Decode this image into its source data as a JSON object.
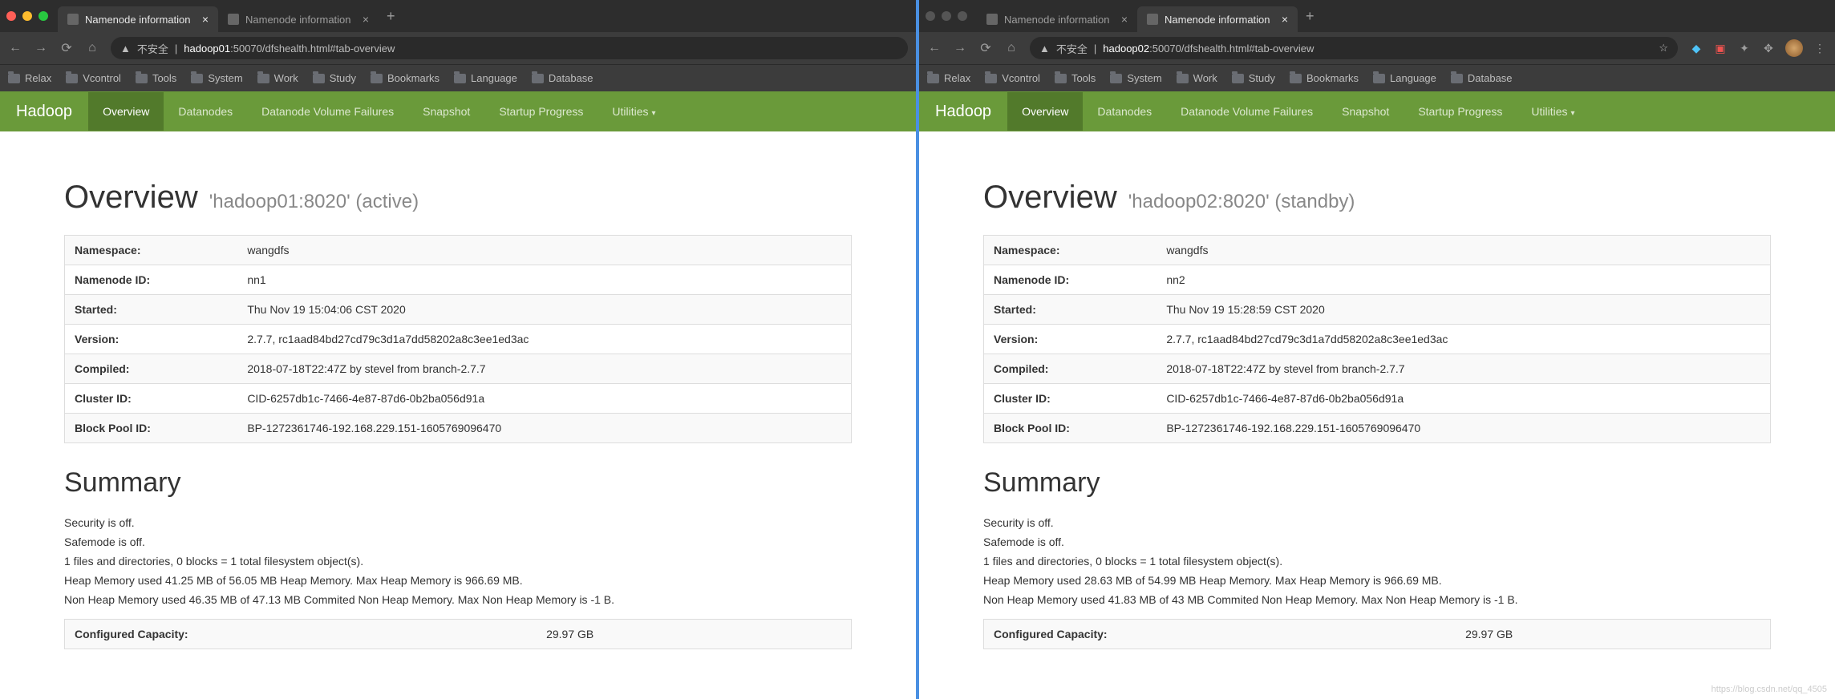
{
  "left": {
    "traffic_colored": true,
    "tabs": [
      {
        "title": "Namenode information",
        "active": true
      },
      {
        "title": "Namenode information",
        "active": false
      }
    ],
    "addr": {
      "warn_icon": "▲",
      "insecure": "不安全",
      "host": "hadoop01",
      "rest": ":50070/dfshealth.html#tab-overview"
    },
    "bookmarks": [
      "Relax",
      "Vcontrol",
      "Tools",
      "System",
      "Work",
      "Study",
      "Bookmarks",
      "Language",
      "Database"
    ],
    "nav": {
      "brand": "Hadoop",
      "items": [
        "Overview",
        "Datanodes",
        "Datanode Volume Failures",
        "Snapshot",
        "Startup Progress",
        "Utilities"
      ],
      "active": 0
    },
    "overview": {
      "title": "Overview",
      "subhost": "'hadoop01:8020' (active)",
      "rows": [
        [
          "Namespace:",
          "wangdfs"
        ],
        [
          "Namenode ID:",
          "nn1"
        ],
        [
          "Started:",
          "Thu Nov 19 15:04:06 CST 2020"
        ],
        [
          "Version:",
          "2.7.7, rc1aad84bd27cd79c3d1a7dd58202a8c3ee1ed3ac"
        ],
        [
          "Compiled:",
          "2018-07-18T22:47Z by stevel from branch-2.7.7"
        ],
        [
          "Cluster ID:",
          "CID-6257db1c-7466-4e87-87d6-0b2ba056d91a"
        ],
        [
          "Block Pool ID:",
          "BP-1272361746-192.168.229.151-1605769096470"
        ]
      ]
    },
    "summary": {
      "title": "Summary",
      "lines": [
        "Security is off.",
        "Safemode is off.",
        "1 files and directories, 0 blocks = 1 total filesystem object(s).",
        "Heap Memory used 41.25 MB of 56.05 MB Heap Memory. Max Heap Memory is 966.69 MB.",
        "Non Heap Memory used 46.35 MB of 47.13 MB Commited Non Heap Memory. Max Non Heap Memory is -1 B."
      ],
      "cap_label": "Configured Capacity:",
      "cap_value": "29.97 GB"
    }
  },
  "right": {
    "traffic_colored": false,
    "tabs": [
      {
        "title": "Namenode information",
        "active": false
      },
      {
        "title": "Namenode information",
        "active": true
      }
    ],
    "addr": {
      "warn_icon": "▲",
      "insecure": "不安全",
      "host": "hadoop02",
      "rest": ":50070/dfshealth.html#tab-overview",
      "star": "☆"
    },
    "ext": true,
    "bookmarks": [
      "Relax",
      "Vcontrol",
      "Tools",
      "System",
      "Work",
      "Study",
      "Bookmarks",
      "Language",
      "Database"
    ],
    "nav": {
      "brand": "Hadoop",
      "items": [
        "Overview",
        "Datanodes",
        "Datanode Volume Failures",
        "Snapshot",
        "Startup Progress",
        "Utilities"
      ],
      "active": 0
    },
    "overview": {
      "title": "Overview",
      "subhost": "'hadoop02:8020' (standby)",
      "rows": [
        [
          "Namespace:",
          "wangdfs"
        ],
        [
          "Namenode ID:",
          "nn2"
        ],
        [
          "Started:",
          "Thu Nov 19 15:28:59 CST 2020"
        ],
        [
          "Version:",
          "2.7.7, rc1aad84bd27cd79c3d1a7dd58202a8c3ee1ed3ac"
        ],
        [
          "Compiled:",
          "2018-07-18T22:47Z by stevel from branch-2.7.7"
        ],
        [
          "Cluster ID:",
          "CID-6257db1c-7466-4e87-87d6-0b2ba056d91a"
        ],
        [
          "Block Pool ID:",
          "BP-1272361746-192.168.229.151-1605769096470"
        ]
      ]
    },
    "summary": {
      "title": "Summary",
      "lines": [
        "Security is off.",
        "Safemode is off.",
        "1 files and directories, 0 blocks = 1 total filesystem object(s).",
        "Heap Memory used 28.63 MB of 54.99 MB Heap Memory. Max Heap Memory is 966.69 MB.",
        "Non Heap Memory used 41.83 MB of 43 MB Commited Non Heap Memory. Max Non Heap Memory is -1 B."
      ],
      "cap_label": "Configured Capacity:",
      "cap_value": "29.97 GB"
    },
    "watermark": "https://blog.csdn.net/qq_4505"
  }
}
